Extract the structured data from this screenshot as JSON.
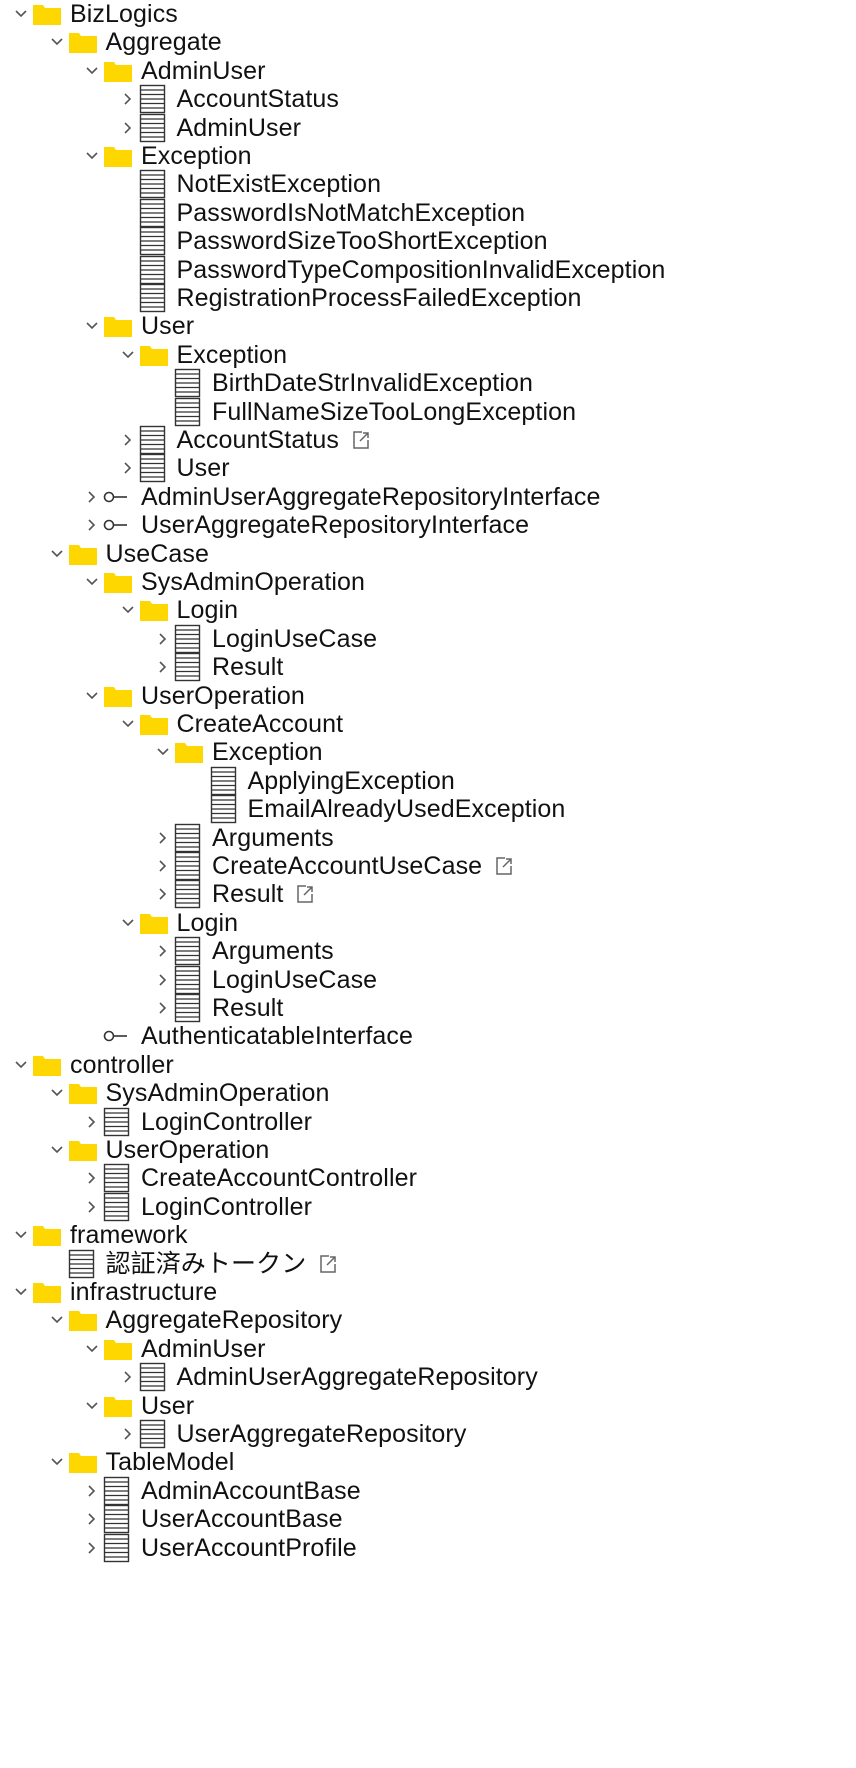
{
  "tree": [
    {
      "label": "BizLogics",
      "type": "folder",
      "depth": 0,
      "expanded": true
    },
    {
      "label": "Aggregate",
      "type": "folder",
      "depth": 1,
      "expanded": true
    },
    {
      "label": "AdminUser",
      "type": "folder",
      "depth": 2,
      "expanded": true
    },
    {
      "label": "AccountStatus",
      "type": "class",
      "depth": 3,
      "expanded": false
    },
    {
      "label": "AdminUser",
      "type": "class",
      "depth": 3,
      "expanded": false
    },
    {
      "label": "Exception",
      "type": "folder",
      "depth": 2,
      "expanded": true
    },
    {
      "label": "NotExistException",
      "type": "class",
      "depth": 3,
      "expanded": null
    },
    {
      "label": "PasswordIsNotMatchException",
      "type": "class",
      "depth": 3,
      "expanded": null
    },
    {
      "label": "PasswordSizeTooShortException",
      "type": "class",
      "depth": 3,
      "expanded": null
    },
    {
      "label": "PasswordTypeCompositionInvalidException",
      "type": "class",
      "depth": 3,
      "expanded": null
    },
    {
      "label": "RegistrationProcessFailedException",
      "type": "class",
      "depth": 3,
      "expanded": null
    },
    {
      "label": "User",
      "type": "folder",
      "depth": 2,
      "expanded": true
    },
    {
      "label": "Exception",
      "type": "folder",
      "depth": 3,
      "expanded": true
    },
    {
      "label": "BirthDateStrInvalidException",
      "type": "class",
      "depth": 4,
      "expanded": null
    },
    {
      "label": "FullNameSizeTooLongException",
      "type": "class",
      "depth": 4,
      "expanded": null
    },
    {
      "label": "AccountStatus",
      "type": "class",
      "depth": 3,
      "expanded": false,
      "external": true
    },
    {
      "label": "User",
      "type": "class",
      "depth": 3,
      "expanded": false
    },
    {
      "label": "AdminUserAggregateRepositoryInterface",
      "type": "interface",
      "depth": 2,
      "expanded": false
    },
    {
      "label": "UserAggregateRepositoryInterface",
      "type": "interface",
      "depth": 2,
      "expanded": false
    },
    {
      "label": "UseCase",
      "type": "folder",
      "depth": 1,
      "expanded": true
    },
    {
      "label": "SysAdminOperation",
      "type": "folder",
      "depth": 2,
      "expanded": true
    },
    {
      "label": "Login",
      "type": "folder",
      "depth": 3,
      "expanded": true
    },
    {
      "label": "LoginUseCase",
      "type": "class",
      "depth": 4,
      "expanded": false
    },
    {
      "label": "Result",
      "type": "class",
      "depth": 4,
      "expanded": false
    },
    {
      "label": "UserOperation",
      "type": "folder",
      "depth": 2,
      "expanded": true
    },
    {
      "label": "CreateAccount",
      "type": "folder",
      "depth": 3,
      "expanded": true
    },
    {
      "label": "Exception",
      "type": "folder",
      "depth": 4,
      "expanded": true
    },
    {
      "label": "ApplyingException",
      "type": "class",
      "depth": 5,
      "expanded": null
    },
    {
      "label": "EmailAlreadyUsedException",
      "type": "class",
      "depth": 5,
      "expanded": null
    },
    {
      "label": "Arguments",
      "type": "class",
      "depth": 4,
      "expanded": false
    },
    {
      "label": "CreateAccountUseCase",
      "type": "class",
      "depth": 4,
      "expanded": false,
      "external": true
    },
    {
      "label": "Result",
      "type": "class",
      "depth": 4,
      "expanded": false,
      "external": true
    },
    {
      "label": "Login",
      "type": "folder",
      "depth": 3,
      "expanded": true
    },
    {
      "label": "Arguments",
      "type": "class",
      "depth": 4,
      "expanded": false
    },
    {
      "label": "LoginUseCase",
      "type": "class",
      "depth": 4,
      "expanded": false
    },
    {
      "label": "Result",
      "type": "class",
      "depth": 4,
      "expanded": false
    },
    {
      "label": "AuthenticatableInterface",
      "type": "interface",
      "depth": 2,
      "expanded": null
    },
    {
      "label": "controller",
      "type": "folder",
      "depth": 0,
      "expanded": true
    },
    {
      "label": "SysAdminOperation",
      "type": "folder",
      "depth": 1,
      "expanded": true
    },
    {
      "label": "LoginController",
      "type": "class",
      "depth": 2,
      "expanded": false
    },
    {
      "label": "UserOperation",
      "type": "folder",
      "depth": 1,
      "expanded": true
    },
    {
      "label": "CreateAccountController",
      "type": "class",
      "depth": 2,
      "expanded": false
    },
    {
      "label": "LoginController",
      "type": "class",
      "depth": 2,
      "expanded": false
    },
    {
      "label": "framework",
      "type": "folder",
      "depth": 0,
      "expanded": true
    },
    {
      "label": "認証済みトークン",
      "type": "class",
      "depth": 1,
      "expanded": null,
      "external": true
    },
    {
      "label": "infrastructure",
      "type": "folder",
      "depth": 0,
      "expanded": true
    },
    {
      "label": "AggregateRepository",
      "type": "folder",
      "depth": 1,
      "expanded": true
    },
    {
      "label": "AdminUser",
      "type": "folder",
      "depth": 2,
      "expanded": true
    },
    {
      "label": "AdminUserAggregateRepository",
      "type": "class",
      "depth": 3,
      "expanded": false
    },
    {
      "label": "User",
      "type": "folder",
      "depth": 2,
      "expanded": true
    },
    {
      "label": "UserAggregateRepository",
      "type": "class",
      "depth": 3,
      "expanded": false
    },
    {
      "label": "TableModel",
      "type": "folder",
      "depth": 1,
      "expanded": true
    },
    {
      "label": "AdminAccountBase",
      "type": "class",
      "depth": 2,
      "expanded": false
    },
    {
      "label": "UserAccountBase",
      "type": "class",
      "depth": 2,
      "expanded": false
    },
    {
      "label": "UserAccountProfile",
      "type": "class",
      "depth": 2,
      "expanded": false
    }
  ],
  "colors": {
    "folder": "#FFD700",
    "text": "#111111",
    "icon_stroke": "#333333",
    "chevron": "#555555",
    "external": "#666666"
  },
  "icons": {
    "folder": "folder-icon",
    "class": "class-table-icon",
    "interface": "interface-icon",
    "external": "external-link-icon",
    "expanded": "chevron-down-icon",
    "collapsed": "chevron-right-icon"
  }
}
